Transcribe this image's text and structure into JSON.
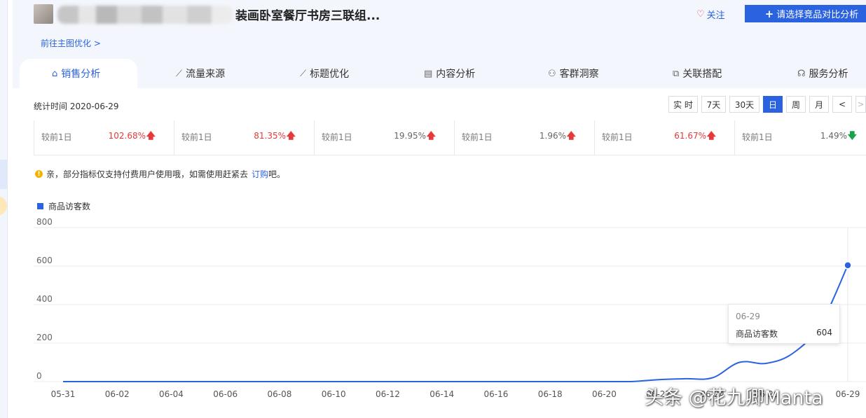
{
  "product": {
    "title": "装画卧室餐厅书房三联组...",
    "follow_label": "关注",
    "compare_label": "请选择竞品对比分析",
    "main_image_link": "前往主图优化 >"
  },
  "tabs": [
    {
      "label": "销售分析",
      "icon": "bag-icon",
      "active": true
    },
    {
      "label": "流量来源",
      "icon": "line-chart-icon"
    },
    {
      "label": "标题优化",
      "icon": "line-chart-icon"
    },
    {
      "label": "内容分析",
      "icon": "document-icon"
    },
    {
      "label": "客群洞察",
      "icon": "people-icon"
    },
    {
      "label": "关联搭配",
      "icon": "link-icon"
    },
    {
      "label": "服务分析",
      "icon": "headset-icon"
    }
  ],
  "toolbar": {
    "stat_time": "统计时间 2020-06-29",
    "buttons": [
      "实 时",
      "7天",
      "30天",
      "日",
      "周",
      "月",
      "<",
      ">"
    ],
    "selected": "日"
  },
  "stats": [
    {
      "label": "较前1日",
      "value": "102.68%",
      "trend": "up"
    },
    {
      "label": "较前1日",
      "value": "81.35%",
      "trend": "up"
    },
    {
      "label": "较前1日",
      "value": "19.95%",
      "trend": "up"
    },
    {
      "label": "较前1日",
      "value": "1.96%",
      "trend": "up"
    },
    {
      "label": "较前1日",
      "value": "61.67%",
      "trend": "up"
    },
    {
      "label": "较前1日",
      "value": "1.49%",
      "trend": "down"
    }
  ],
  "notice": {
    "text": "亲，部分指标仅支持付费用户使用哦，如需使用赶紧去",
    "link": "订购",
    "suffix": "吧。"
  },
  "colors": {
    "accent": "#2a62e0",
    "up": "#e23a3a",
    "down": "#1aa34a"
  },
  "chart_data": {
    "type": "line",
    "legend": [
      "商品访客数"
    ],
    "ylim": [
      0,
      800
    ],
    "yticks": [
      0,
      200,
      400,
      600,
      800
    ],
    "x_tick_labels": [
      "05-31",
      "06-02",
      "06-04",
      "06-06",
      "06-08",
      "06-10",
      "06-12",
      "06-14",
      "06-16",
      "06-18",
      "06-20",
      "06-22",
      "06-24",
      "06-26",
      "06-29"
    ],
    "series": [
      {
        "name": "商品访客数",
        "x": [
          "05-31",
          "06-01",
          "06-02",
          "06-03",
          "06-04",
          "06-05",
          "06-06",
          "06-07",
          "06-08",
          "06-09",
          "06-10",
          "06-11",
          "06-12",
          "06-13",
          "06-14",
          "06-15",
          "06-16",
          "06-17",
          "06-18",
          "06-19",
          "06-20",
          "06-21",
          "06-22",
          "06-23",
          "06-24",
          "06-25",
          "06-26",
          "06-27",
          "06-28",
          "06-29"
        ],
        "values": [
          0,
          0,
          0,
          0,
          0,
          0,
          0,
          0,
          0,
          0,
          0,
          0,
          0,
          0,
          0,
          0,
          0,
          0,
          0,
          0,
          0,
          0,
          10,
          15,
          20,
          100,
          95,
          150,
          300,
          604
        ]
      }
    ],
    "tooltip": {
      "date": "06-29",
      "series": "商品访客数",
      "value": "604"
    }
  },
  "watermark": "头条 @花九卿Manta"
}
